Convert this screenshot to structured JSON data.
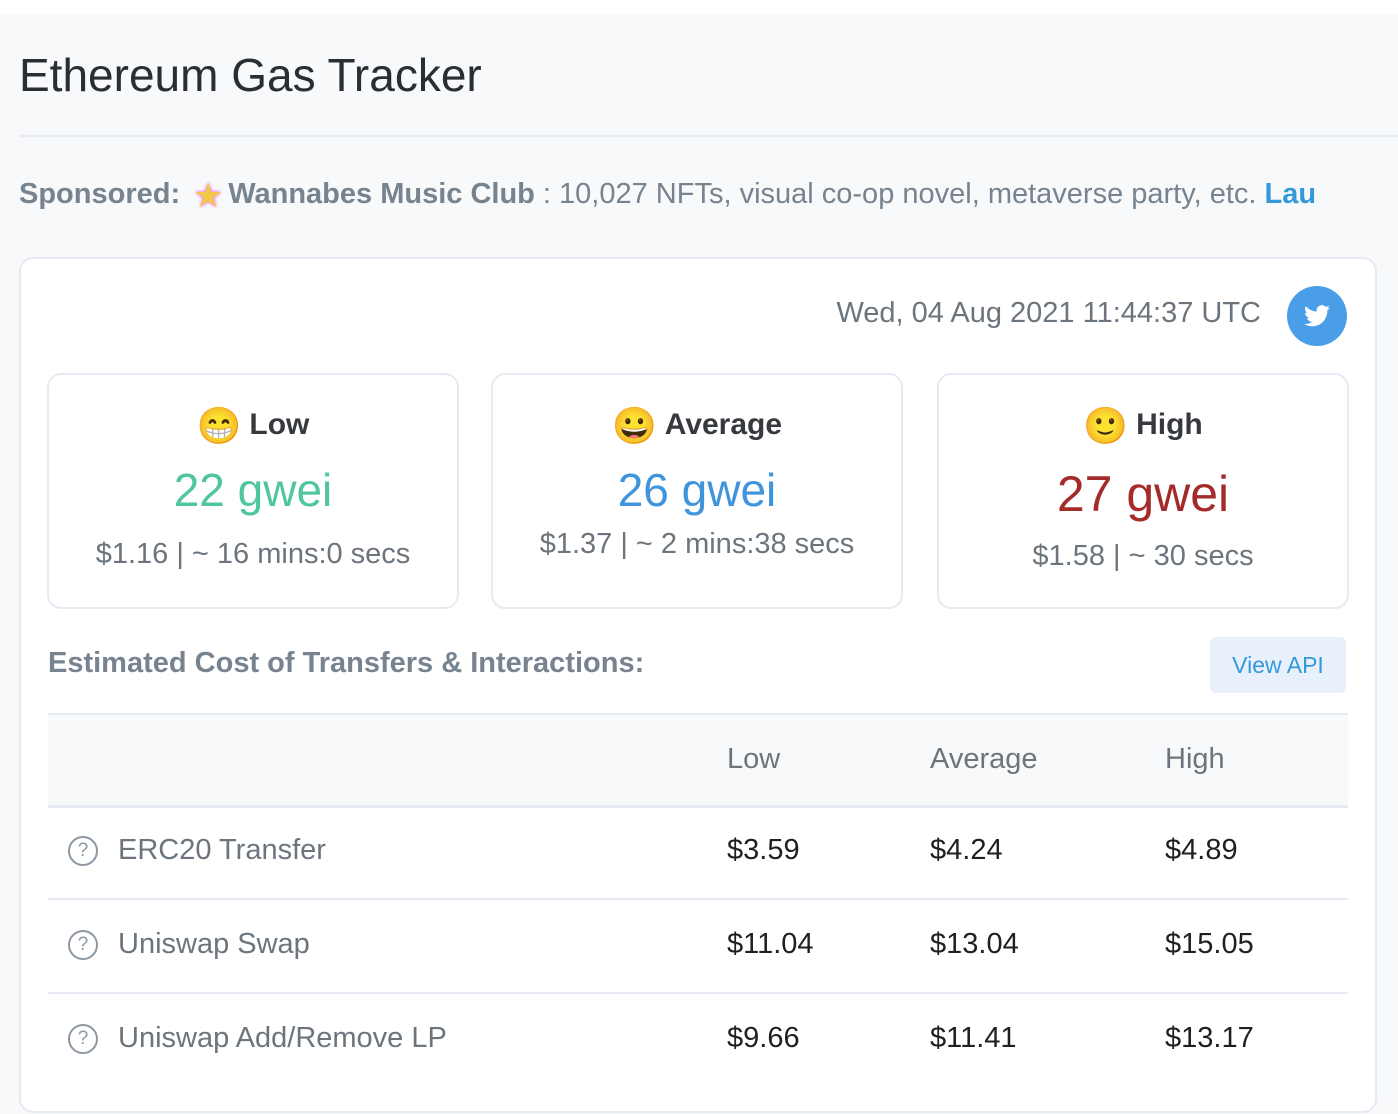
{
  "title": "Ethereum Gas Tracker",
  "sponsored": {
    "label": "Sponsored:",
    "name": "Wannabes Music Club",
    "text": " : 10,027 NFTs, visual co-op novel, metaverse party, etc. ",
    "link": "Lau"
  },
  "timestamp": "Wed, 04 Aug 2021 11:44:37 UTC",
  "tiers": [
    {
      "emoji": "😁",
      "label": "Low",
      "gwei": "22 gwei",
      "sub": "$1.16 | ~ 16 mins:0 secs",
      "color": "#4fc5a0"
    },
    {
      "emoji": "😀",
      "label": "Average",
      "gwei": "26 gwei",
      "sub": "$1.37 | ~ 2 mins:38 secs",
      "color": "#3f94dc"
    },
    {
      "emoji": "🙂",
      "label": "High",
      "gwei": "27 gwei",
      "sub": "$1.58 | ~ 30 secs",
      "color": "#a52a2a"
    }
  ],
  "estimate": {
    "heading": "Estimated Cost of Transfers & Interactions:",
    "api_button": "View API",
    "columns": [
      "Low",
      "Average",
      "High"
    ],
    "rows": [
      {
        "name": "ERC20 Transfer",
        "values": [
          "$3.59",
          "$4.24",
          "$4.89"
        ]
      },
      {
        "name": "Uniswap Swap",
        "values": [
          "$11.04",
          "$13.04",
          "$15.05"
        ]
      },
      {
        "name": "Uniswap Add/Remove LP",
        "values": [
          "$9.66",
          "$11.41",
          "$13.17"
        ]
      }
    ]
  }
}
